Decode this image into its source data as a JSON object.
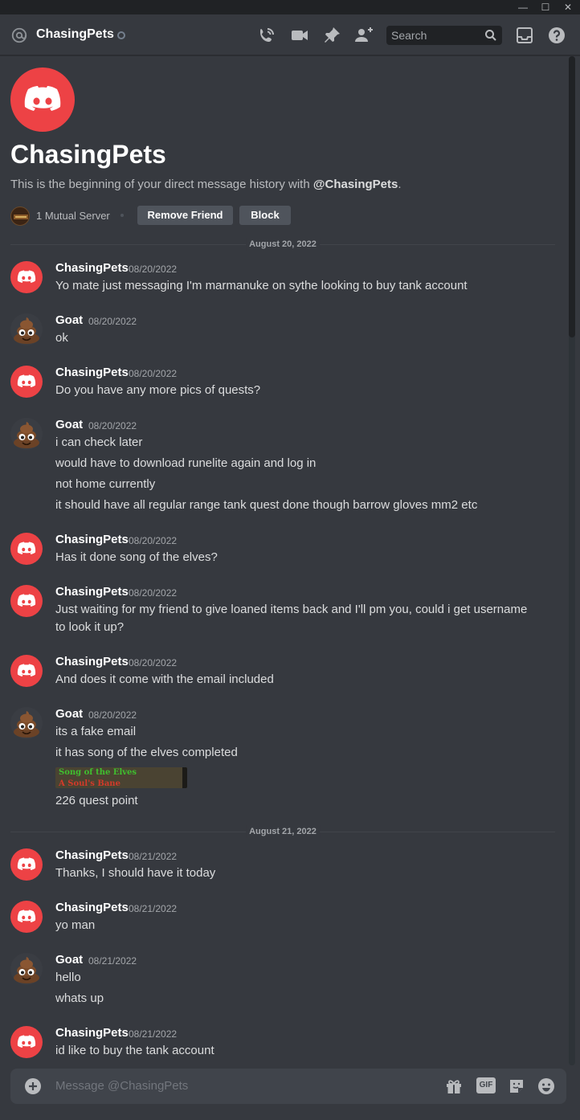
{
  "window": {
    "minimize_glyph": "—",
    "maximize_glyph": "☐",
    "close_glyph": "✕"
  },
  "header": {
    "name": "ChasingPets",
    "search_placeholder": "Search",
    "icons": [
      "at-icon",
      "voice-call-icon",
      "video-call-icon",
      "pin-icon",
      "add-friend-icon",
      "search-icon",
      "inbox-icon",
      "help-icon"
    ]
  },
  "intro": {
    "title": "ChasingPets",
    "text_prefix": "This is the beginning of your direct message history with ",
    "text_mention": "@ChasingPets",
    "text_suffix": ".",
    "mutual_servers": "1 Mutual Server",
    "remove_friend_label": "Remove Friend",
    "block_label": "Block"
  },
  "dates": {
    "d1": "August 20, 2022",
    "d2": "August 21, 2022"
  },
  "messages": [
    {
      "author": "ChasingPets",
      "ts": "08/20/2022",
      "lines": [
        "Yo mate just messaging I'm marmanuke on sythe looking to buy tank account"
      ]
    },
    {
      "author": "Goat",
      "ts": "08/20/2022",
      "lines": [
        "ok"
      ]
    },
    {
      "author": "ChasingPets",
      "ts": "08/20/2022",
      "lines": [
        "Do you have any more pics of quests?"
      ]
    },
    {
      "author": "Goat",
      "ts": "08/20/2022",
      "lines": [
        "i can check later",
        "would have to download runelite again and log in",
        "not home currently",
        "it should have all regular range tank quest done though barrow gloves mm2 etc"
      ]
    },
    {
      "author": "ChasingPets",
      "ts": "08/20/2022",
      "lines": [
        "Has it done song of the elves?"
      ]
    },
    {
      "author": "ChasingPets",
      "ts": "08/20/2022",
      "lines": [
        "Just waiting for my friend to give loaned items back and I'll pm you, could i get username",
        "to look it up?"
      ]
    },
    {
      "author": "ChasingPets",
      "ts": "08/20/2022",
      "lines": [
        "And does it come with the email included"
      ]
    },
    {
      "author": "Goat",
      "ts": "08/20/2022",
      "lines": [
        "its a fake email",
        "it has song of the elves completed",
        "226 quest point"
      ]
    },
    {
      "author": "ChasingPets",
      "ts": "08/21/2022",
      "lines": [
        "Thanks, I should have it today"
      ]
    },
    {
      "author": "ChasingPets",
      "ts": "08/21/2022",
      "lines": [
        "yo man"
      ]
    },
    {
      "author": "Goat",
      "ts": "08/21/2022",
      "lines": [
        "hello",
        "whats up"
      ]
    },
    {
      "author": "ChasingPets",
      "ts": "08/21/2022",
      "lines": [
        "id like to buy the tank account"
      ]
    }
  ],
  "attachment": {
    "line1": "Song of the Elves",
    "line2": "A Soul's Bane"
  },
  "composer": {
    "placeholder": "Message @ChasingPets",
    "gif_label": "GIF",
    "icons": [
      "add-attachment-icon",
      "gift-icon",
      "gif-icon",
      "sticker-icon",
      "emoji-icon"
    ]
  },
  "colors": {
    "background": "#36393f",
    "brand_red": "#ed4245",
    "button": "#4f545c",
    "text": "#dcddde"
  }
}
